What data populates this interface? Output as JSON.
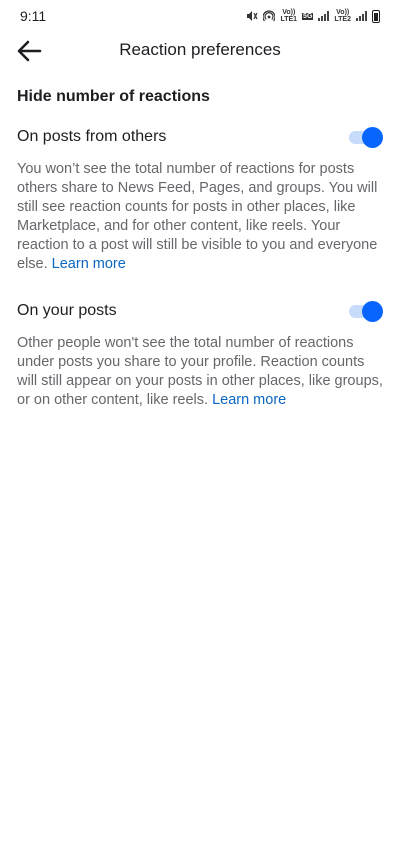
{
  "status_bar": {
    "time": "9:11",
    "volte1": "Vo))",
    "lte1": "LTE1",
    "net": "5G",
    "volte2": "Vo))",
    "lte2": "LTE2"
  },
  "header": {
    "title": "Reaction preferences",
    "back_icon": "arrow-left-icon"
  },
  "main": {
    "section_title": "Hide number of reactions",
    "settings": [
      {
        "label": "On posts from others",
        "enabled": true,
        "description": "You won’t see the total number of reactions for posts others share to News Feed, Pages, and groups. You will still see reaction counts for posts in other places, like Marketplace, and for other content, like reels. Your reaction to a post will still be visible to you and everyone else.",
        "link": "Learn more"
      },
      {
        "label": "On your posts",
        "enabled": true,
        "description": "Other people won't see the total number of reactions under posts you share to your profile. Reaction counts will still appear on your posts in other places, like groups, or on other content, like reels.",
        "link": "Learn more"
      }
    ]
  },
  "colors": {
    "accent": "#0866ff",
    "toggle_track": "#c7dcfb",
    "link": "#0a66c2",
    "secondary_text": "#65676b"
  }
}
